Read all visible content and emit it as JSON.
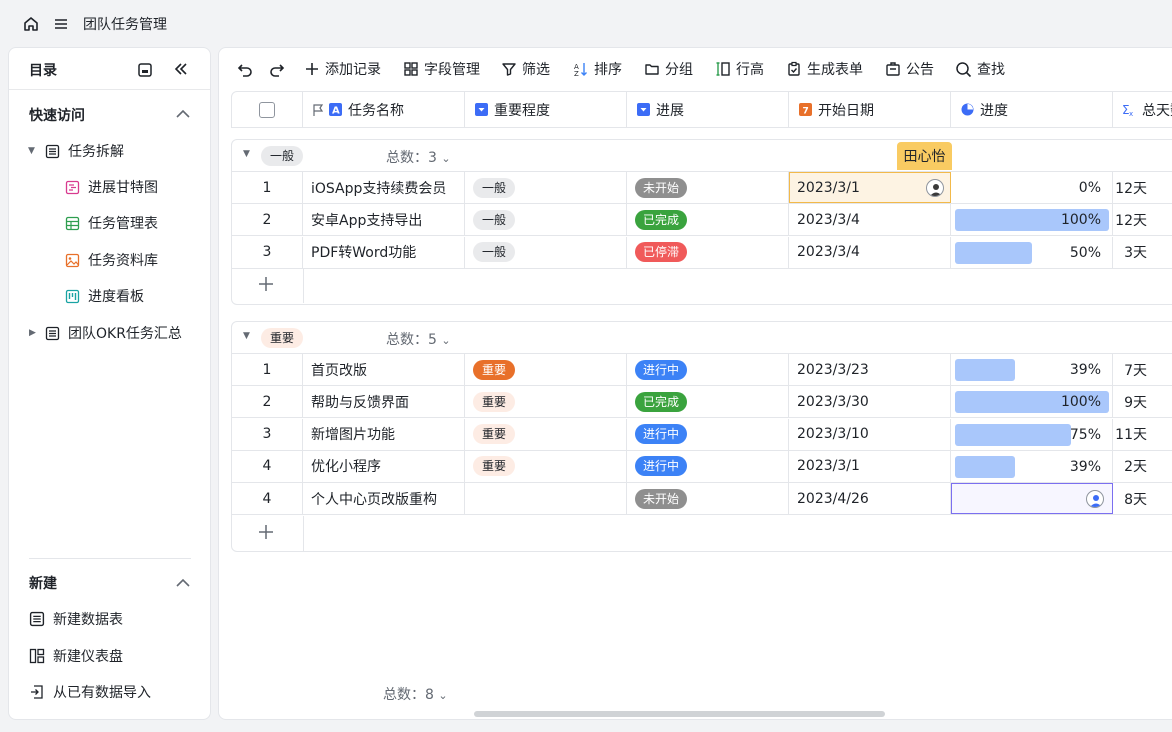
{
  "app": {
    "title": "团队任务管理"
  },
  "sidebar": {
    "title": "目录",
    "quick_access": {
      "title": "快速访问",
      "items": [
        {
          "label": "任务拆解"
        },
        {
          "label": "进展甘特图"
        },
        {
          "label": "任务管理表"
        },
        {
          "label": "任务资料库"
        },
        {
          "label": "进度看板"
        },
        {
          "label": "团队OKR任务汇总"
        }
      ]
    },
    "new_section": {
      "title": "新建",
      "items": [
        {
          "label": "新建数据表"
        },
        {
          "label": "新建仪表盘"
        },
        {
          "label": "从已有数据导入"
        }
      ]
    }
  },
  "toolbar": {
    "add_record": "添加记录",
    "field_manage": "字段管理",
    "filter": "筛选",
    "sort": "排序",
    "group": "分组",
    "row_height": "行高",
    "generate_form": "生成表单",
    "notice": "公告",
    "search": "查找"
  },
  "columns": {
    "name": "任务名称",
    "importance": "重要程度",
    "status": "进展",
    "start_date": "开始日期",
    "progress": "进度",
    "total_days": "总天数"
  },
  "tooltip": "田心怡",
  "groups": [
    {
      "tag": "一般",
      "count_label": "总数：3",
      "rows": [
        {
          "num": "1",
          "name": "iOSApp支持续费会员",
          "importance": "一般",
          "status": "未开始",
          "date": "2023/3/1",
          "progress": 0,
          "progress_label": "0%",
          "days": "12天"
        },
        {
          "num": "2",
          "name": "安卓App支持导出",
          "importance": "一般",
          "status": "已完成",
          "date": "2023/3/4",
          "progress": 1.0,
          "progress_label": "100%",
          "days": "12天"
        },
        {
          "num": "3",
          "name": "PDF转Word功能",
          "importance": "一般",
          "status": "已停滞",
          "date": "2023/3/4",
          "progress": 0.5,
          "progress_label": "50%",
          "days": "3天"
        }
      ]
    },
    {
      "tag": "重要",
      "count_label": "总数：5",
      "rows": [
        {
          "num": "1",
          "name": "首页改版",
          "importance": "重要",
          "status": "进行中",
          "date": "2023/3/23",
          "progress": 0.39,
          "progress_label": "39%",
          "days": "7天"
        },
        {
          "num": "2",
          "name": "帮助与反馈界面",
          "importance": "重要",
          "status": "已完成",
          "date": "2023/3/30",
          "progress": 1.0,
          "progress_label": "100%",
          "days": "9天"
        },
        {
          "num": "3",
          "name": "新增图片功能",
          "importance": "重要",
          "status": "进行中",
          "date": "2023/3/10",
          "progress": 0.75,
          "progress_label": "75%",
          "days": "11天"
        },
        {
          "num": "4",
          "name": "优化小程序",
          "importance": "重要",
          "status": "进行中",
          "date": "2023/3/1",
          "progress": 0.39,
          "progress_label": "39%",
          "days": "2天"
        },
        {
          "num": "4",
          "name": "个人中心页改版重构",
          "importance": "",
          "status": "未开始",
          "date": "2023/4/26",
          "progress": null,
          "progress_label": "",
          "days": "8天"
        }
      ]
    }
  ],
  "footer": {
    "total_label": "总数：8"
  },
  "colors": {
    "status_not_started": "#8f8f8f",
    "status_done": "#3aa33e",
    "status_stalled": "#f05a5a",
    "status_in_progress": "#3c82f6",
    "progress_bar": "#a9c7fb",
    "tooltip": "#f9cb62"
  }
}
